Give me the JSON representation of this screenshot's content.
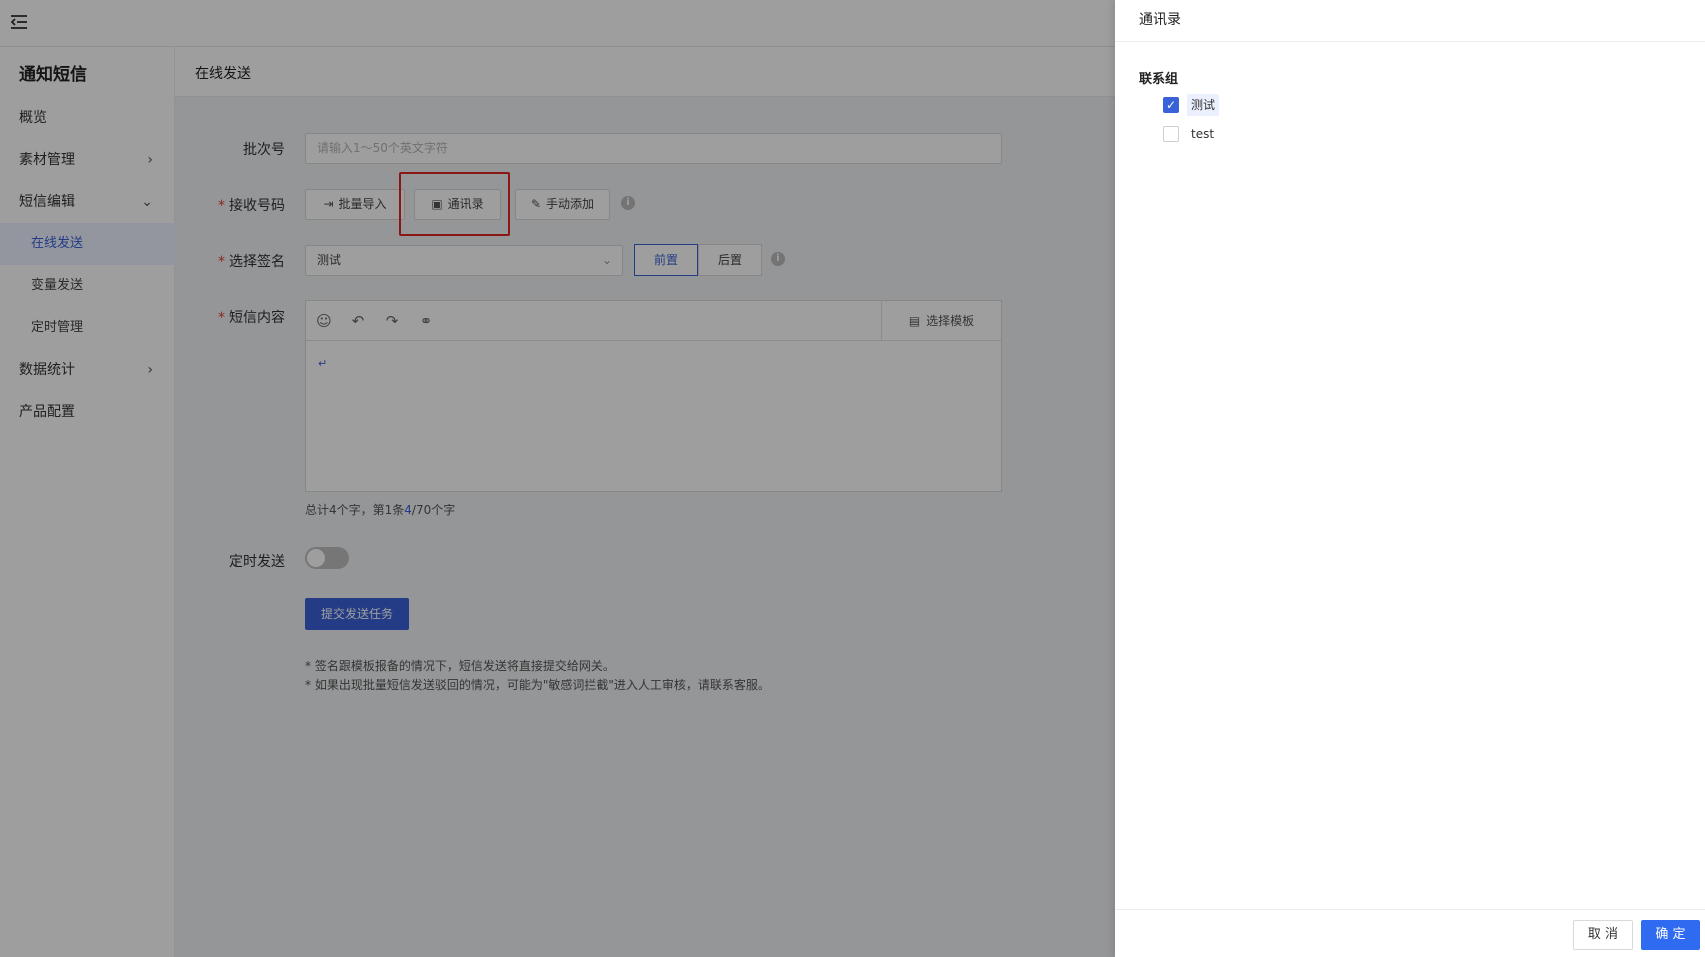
{
  "sidebar": {
    "title": "通知短信",
    "items": [
      {
        "label": "概览"
      },
      {
        "label": "素材管理"
      },
      {
        "label": "短信编辑"
      },
      {
        "label": "数据统计"
      },
      {
        "label": "产品配置"
      }
    ],
    "subitems": [
      {
        "label": "在线发送",
        "active": true
      },
      {
        "label": "变量发送"
      },
      {
        "label": "定时管理"
      }
    ]
  },
  "page": {
    "title": "在线发送"
  },
  "form": {
    "batch_label": "批次号",
    "batch_placeholder": "请输入1～50个英文字符",
    "recipient_label": "接收号码",
    "recipient_buttons": {
      "batch_import": "批量导入",
      "contacts": "通讯录",
      "manual_add": "手动添加"
    },
    "signature_label": "选择签名",
    "signature_value": "测试",
    "position": {
      "front": "前置",
      "back": "后置",
      "selected": "前置"
    },
    "content_label": "短信内容",
    "template_button": "选择模板",
    "editor_caret": "↵",
    "count_prefix": "总计4个字，第1条",
    "count_highlight": "4",
    "count_suffix": "/70个字",
    "schedule_label": "定时发送",
    "schedule_on": false,
    "submit": "提交发送任务",
    "notes": [
      "* 签名跟模板报备的情况下，短信发送将直接提交给网关。",
      "* 如果出现批量短信发送驳回的情况，可能为\"敏感词拦截\"进入人工审核，请联系客服。"
    ]
  },
  "drawer": {
    "title": "通讯录",
    "group_label": "联系组",
    "groups": [
      {
        "label": "测试",
        "checked": true
      },
      {
        "label": "test",
        "checked": false
      }
    ],
    "cancel": "取 消",
    "ok": "确 定"
  },
  "colors": {
    "accent": "#3a62d8",
    "highlight_box": "#e02424",
    "required": "#e23d3d"
  }
}
